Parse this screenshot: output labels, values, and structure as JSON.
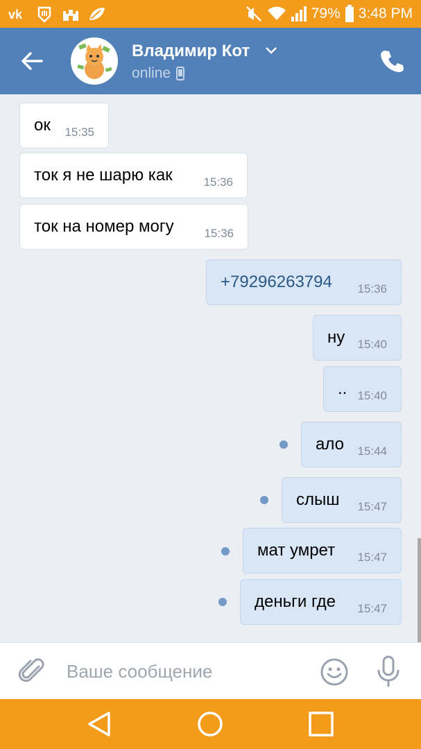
{
  "status_bar": {
    "battery": "79%",
    "time": "3:48 PM",
    "left_icons": [
      "vk-icon",
      "hand-icon",
      "castle-icon",
      "leaf-icon"
    ],
    "right_icons": [
      "mute-icon",
      "wifi-icon",
      "signal-icon",
      "battery-icon"
    ]
  },
  "header": {
    "contact_name": "Владимир Кот",
    "status": "online",
    "status_icon": "phone-small-icon"
  },
  "messages": [
    {
      "dir": "in",
      "text": "ок",
      "time": "15:35"
    },
    {
      "dir": "in",
      "text": "ток я не шарю как",
      "time": "15:36"
    },
    {
      "dir": "in",
      "text": "ток на номер могу",
      "time": "15:36"
    },
    {
      "dir": "out",
      "text": "+79296263794",
      "time": "15:36",
      "link": true
    },
    {
      "dir": "out",
      "text": "ну",
      "time": "15:40"
    },
    {
      "dir": "out",
      "text": "..",
      "time": "15:40"
    },
    {
      "dir": "out",
      "text": "ало",
      "time": "15:44",
      "unread": true
    },
    {
      "dir": "out",
      "text": "слыш",
      "time": "15:47",
      "unread": true
    },
    {
      "dir": "out",
      "text": "мат умрет",
      "time": "15:47",
      "unread": true
    },
    {
      "dir": "out",
      "text": "деньги где",
      "time": "15:47",
      "unread": true
    }
  ],
  "composer": {
    "placeholder": "Ваше сообщение"
  },
  "colors": {
    "accent_orange": "#f39c1c",
    "header_blue": "#5181b8",
    "outgoing_bubble": "#d9e6f5",
    "incoming_bubble": "#ffffff",
    "link": "#2a5885",
    "unread_dot": "#7499c6"
  }
}
